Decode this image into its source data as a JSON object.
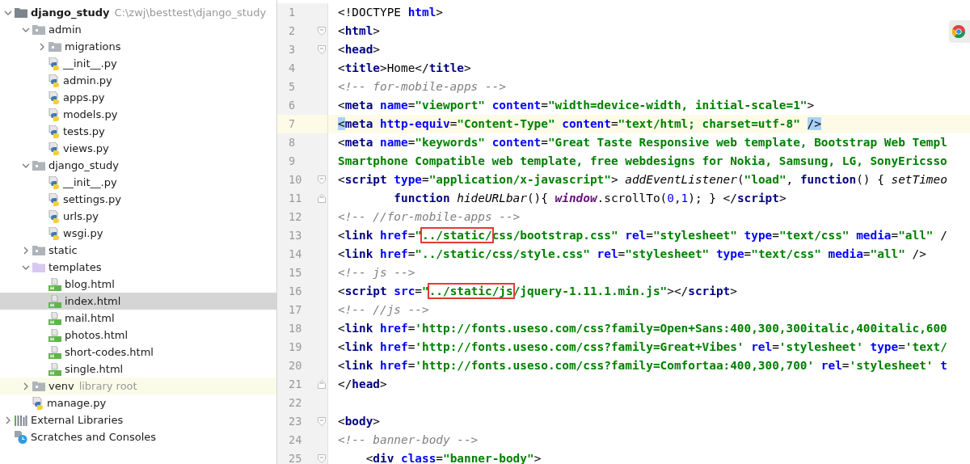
{
  "project_tree": {
    "root": {
      "name": "django_study",
      "path": "C:\\zwj\\besttest\\django_study",
      "expanded": true
    },
    "children": [
      {
        "kind": "folder",
        "name": "admin",
        "expanded": true,
        "selected": false,
        "children": [
          {
            "kind": "folder",
            "name": "migrations",
            "expanded": false,
            "selected": false
          },
          {
            "kind": "py",
            "name": "__init__.py",
            "selected": false
          },
          {
            "kind": "py",
            "name": "admin.py",
            "selected": false
          },
          {
            "kind": "py",
            "name": "apps.py",
            "selected": false
          },
          {
            "kind": "py",
            "name": "models.py",
            "selected": false
          },
          {
            "kind": "py",
            "name": "tests.py",
            "selected": false
          },
          {
            "kind": "py",
            "name": "views.py",
            "selected": false
          }
        ]
      },
      {
        "kind": "folder",
        "name": "django_study",
        "expanded": true,
        "selected": false,
        "children": [
          {
            "kind": "py",
            "name": "__init__.py",
            "selected": false
          },
          {
            "kind": "py",
            "name": "settings.py",
            "selected": false
          },
          {
            "kind": "py",
            "name": "urls.py",
            "selected": false
          },
          {
            "kind": "py",
            "name": "wsgi.py",
            "selected": false
          }
        ]
      },
      {
        "kind": "folder",
        "name": "static",
        "expanded": false,
        "selected": false
      },
      {
        "kind": "templates",
        "name": "templates",
        "expanded": true,
        "selected": false,
        "children": [
          {
            "kind": "html",
            "name": "blog.html",
            "selected": false
          },
          {
            "kind": "html",
            "name": "index.html",
            "selected": true
          },
          {
            "kind": "html",
            "name": "mail.html",
            "selected": false
          },
          {
            "kind": "html",
            "name": "photos.html",
            "selected": false
          },
          {
            "kind": "html",
            "name": "short-codes.html",
            "selected": false
          },
          {
            "kind": "html",
            "name": "single.html",
            "selected": false
          }
        ]
      },
      {
        "kind": "folder",
        "name": "venv",
        "hint": "library root",
        "expanded": false,
        "selected": false
      },
      {
        "kind": "py",
        "name": "manage.py",
        "selected": false
      }
    ],
    "extra": [
      {
        "kind": "libraries",
        "name": "External Libraries",
        "expanded": false
      },
      {
        "kind": "scratches",
        "name": "Scratches and Consoles"
      }
    ]
  },
  "editor": {
    "lines": [
      {
        "number": "1",
        "current": false,
        "tokens": [
          {
            "kind": "p",
            "text": "<!DOCTYPE"
          },
          {
            "kind": "attr",
            "text": " html"
          },
          {
            "kind": "p",
            "text": ">"
          }
        ]
      },
      {
        "number": "2",
        "current": false,
        "fold_start": true,
        "tokens": [
          {
            "kind": "p",
            "text": "<"
          },
          {
            "kind": "tag",
            "text": "html"
          },
          {
            "kind": "p",
            "text": ">"
          }
        ]
      },
      {
        "number": "3",
        "current": false,
        "fold_start": true,
        "tokens": [
          {
            "kind": "p",
            "text": "<"
          },
          {
            "kind": "tag",
            "text": "head"
          },
          {
            "kind": "p",
            "text": ">"
          }
        ]
      },
      {
        "number": "4",
        "current": false,
        "tokens": [
          {
            "kind": "p",
            "text": "<"
          },
          {
            "kind": "tag",
            "text": "title"
          },
          {
            "kind": "p",
            "text": ">"
          },
          {
            "kind": "text",
            "text": "Home"
          },
          {
            "kind": "p",
            "text": "</"
          },
          {
            "kind": "tag",
            "text": "title"
          },
          {
            "kind": "p",
            "text": ">"
          }
        ]
      },
      {
        "number": "5",
        "current": false,
        "tokens": [
          {
            "kind": "comment",
            "text": "<!-- for-mobile-apps -->"
          }
        ]
      },
      {
        "number": "6",
        "current": false,
        "tokens": [
          {
            "kind": "p",
            "text": "<"
          },
          {
            "kind": "tag",
            "text": "meta"
          },
          {
            "kind": "attr",
            "text": " name"
          },
          {
            "kind": "p",
            "text": "="
          },
          {
            "kind": "str",
            "text": "\"viewport\""
          },
          {
            "kind": "attr",
            "text": " content"
          },
          {
            "kind": "p",
            "text": "="
          },
          {
            "kind": "str",
            "text": "\"width=device-width, initial-scale=1\""
          },
          {
            "kind": "p",
            "text": ">"
          }
        ]
      },
      {
        "number": "7",
        "current": true,
        "tokens": [
          {
            "kind": "pm",
            "text": "<"
          },
          {
            "kind": "tag",
            "text": "meta"
          },
          {
            "kind": "attr",
            "text": " http-equiv"
          },
          {
            "kind": "p",
            "text": "="
          },
          {
            "kind": "str",
            "text": "\"Content-Type\""
          },
          {
            "kind": "attr",
            "text": " content"
          },
          {
            "kind": "p",
            "text": "="
          },
          {
            "kind": "str",
            "text": "\"text/html; charset=utf-8\" "
          },
          {
            "kind": "pm",
            "text": "/>"
          }
        ]
      },
      {
        "number": "8",
        "current": false,
        "tokens": [
          {
            "kind": "p",
            "text": "<"
          },
          {
            "kind": "tag",
            "text": "meta"
          },
          {
            "kind": "attr",
            "text": " name"
          },
          {
            "kind": "p",
            "text": "="
          },
          {
            "kind": "str",
            "text": "\"keywords\""
          },
          {
            "kind": "attr",
            "text": " content"
          },
          {
            "kind": "p",
            "text": "="
          },
          {
            "kind": "str",
            "text": "\"Great Taste Responsive web template, Bootstrap Web Templ"
          }
        ]
      },
      {
        "number": "9",
        "current": false,
        "tokens": [
          {
            "kind": "str",
            "text": "Smartphone Compatible web template, free webdesigns for Nokia, Samsung, LG, SonyEricsso"
          }
        ]
      },
      {
        "number": "10",
        "current": false,
        "fold_start": true,
        "tokens": [
          {
            "kind": "p",
            "text": "<"
          },
          {
            "kind": "tag",
            "text": "script"
          },
          {
            "kind": "attr",
            "text": " type"
          },
          {
            "kind": "p",
            "text": "="
          },
          {
            "kind": "str",
            "text": "\"application/x-javascript\""
          },
          {
            "kind": "p",
            "text": ">"
          },
          {
            "kind": "it",
            "text": " addEventListener"
          },
          {
            "kind": "p",
            "text": "("
          },
          {
            "kind": "str",
            "text": "\"load\""
          },
          {
            "kind": "p",
            "text": ","
          },
          {
            "kind": "kw",
            "text": " function"
          },
          {
            "kind": "p",
            "text": "() {"
          },
          {
            "kind": "it",
            "text": " setTimeo"
          }
        ]
      },
      {
        "number": "11",
        "current": false,
        "fold_end": true,
        "tokens": [
          {
            "kind": "kw",
            "text": "        function"
          },
          {
            "kind": "it",
            "text": " hideURLbar"
          },
          {
            "kind": "p",
            "text": "(){"
          },
          {
            "kind": "glob",
            "text": " window"
          },
          {
            "kind": "p",
            "text": ".scrollTo("
          },
          {
            "kind": "num",
            "text": "0"
          },
          {
            "kind": "p",
            "text": ","
          },
          {
            "kind": "num",
            "text": "1"
          },
          {
            "kind": "p",
            "text": "); } </"
          },
          {
            "kind": "tag",
            "text": "script"
          },
          {
            "kind": "p",
            "text": ">"
          }
        ]
      },
      {
        "number": "12",
        "current": false,
        "tokens": [
          {
            "kind": "comment",
            "text": "<!-- //for-mobile-apps -->"
          }
        ]
      },
      {
        "number": "13",
        "current": false,
        "tokens": [
          {
            "kind": "p",
            "text": "<"
          },
          {
            "kind": "tag",
            "text": "link"
          },
          {
            "kind": "attr",
            "text": " href"
          },
          {
            "kind": "p",
            "text": "="
          },
          {
            "kind": "str",
            "text": "\""
          },
          {
            "kind": "boxed",
            "text": "../static/"
          },
          {
            "kind": "str",
            "text": "css/bootstrap.css\""
          },
          {
            "kind": "attr",
            "text": " rel"
          },
          {
            "kind": "p",
            "text": "="
          },
          {
            "kind": "str",
            "text": "\"stylesheet\""
          },
          {
            "kind": "attr",
            "text": " type"
          },
          {
            "kind": "p",
            "text": "="
          },
          {
            "kind": "str",
            "text": "\"text/css\""
          },
          {
            "kind": "attr",
            "text": " media"
          },
          {
            "kind": "p",
            "text": "="
          },
          {
            "kind": "str",
            "text": "\"all\""
          },
          {
            "kind": "p",
            "text": " /"
          }
        ]
      },
      {
        "number": "14",
        "current": false,
        "tokens": [
          {
            "kind": "p",
            "text": "<"
          },
          {
            "kind": "tag",
            "text": "link"
          },
          {
            "kind": "attr",
            "text": " href"
          },
          {
            "kind": "p",
            "text": "="
          },
          {
            "kind": "str",
            "text": "\"../static/css/style.css\""
          },
          {
            "kind": "attr",
            "text": " rel"
          },
          {
            "kind": "p",
            "text": "="
          },
          {
            "kind": "str",
            "text": "\"stylesheet\""
          },
          {
            "kind": "attr",
            "text": " type"
          },
          {
            "kind": "p",
            "text": "="
          },
          {
            "kind": "str",
            "text": "\"text/css\""
          },
          {
            "kind": "attr",
            "text": " media"
          },
          {
            "kind": "p",
            "text": "="
          },
          {
            "kind": "str",
            "text": "\"all\""
          },
          {
            "kind": "p",
            "text": " />"
          }
        ]
      },
      {
        "number": "15",
        "current": false,
        "tokens": [
          {
            "kind": "comment",
            "text": "<!-- js -->"
          }
        ]
      },
      {
        "number": "16",
        "current": false,
        "tokens": [
          {
            "kind": "p",
            "text": "<"
          },
          {
            "kind": "tag",
            "text": "script"
          },
          {
            "kind": "attr",
            "text": " src"
          },
          {
            "kind": "p",
            "text": "="
          },
          {
            "kind": "str",
            "text": "\""
          },
          {
            "kind": "boxed",
            "text": "../static/js"
          },
          {
            "kind": "str",
            "text": "/jquery-1.11.1.min.js\""
          },
          {
            "kind": "p",
            "text": "></"
          },
          {
            "kind": "tag",
            "text": "script"
          },
          {
            "kind": "p",
            "text": ">"
          }
        ]
      },
      {
        "number": "17",
        "current": false,
        "tokens": [
          {
            "kind": "comment",
            "text": "<!-- //js -->"
          }
        ]
      },
      {
        "number": "18",
        "current": false,
        "tokens": [
          {
            "kind": "p",
            "text": "<"
          },
          {
            "kind": "tag",
            "text": "link"
          },
          {
            "kind": "attr",
            "text": " href"
          },
          {
            "kind": "p",
            "text": "="
          },
          {
            "kind": "str",
            "text": "'http://fonts.useso.com/css?family=Open+Sans:400,300,300italic,400italic,600"
          }
        ]
      },
      {
        "number": "19",
        "current": false,
        "tokens": [
          {
            "kind": "p",
            "text": "<"
          },
          {
            "kind": "tag",
            "text": "link"
          },
          {
            "kind": "attr",
            "text": " href"
          },
          {
            "kind": "p",
            "text": "="
          },
          {
            "kind": "str",
            "text": "'http://fonts.useso.com/css?family=Great+Vibes'"
          },
          {
            "kind": "attr",
            "text": " rel"
          },
          {
            "kind": "p",
            "text": "="
          },
          {
            "kind": "str",
            "text": "'stylesheet'"
          },
          {
            "kind": "attr",
            "text": " type"
          },
          {
            "kind": "p",
            "text": "="
          },
          {
            "kind": "str",
            "text": "'text/"
          }
        ]
      },
      {
        "number": "20",
        "current": false,
        "tokens": [
          {
            "kind": "p",
            "text": "<"
          },
          {
            "kind": "tag",
            "text": "link"
          },
          {
            "kind": "attr",
            "text": " href"
          },
          {
            "kind": "p",
            "text": "="
          },
          {
            "kind": "str",
            "text": "'http://fonts.useso.com/css?family=Comfortaa:400,300,700'"
          },
          {
            "kind": "attr",
            "text": " rel"
          },
          {
            "kind": "p",
            "text": "="
          },
          {
            "kind": "str",
            "text": "'stylesheet'"
          },
          {
            "kind": "attr",
            "text": " t"
          }
        ]
      },
      {
        "number": "21",
        "current": false,
        "fold_end": true,
        "tokens": [
          {
            "kind": "p",
            "text": "</"
          },
          {
            "kind": "tag",
            "text": "head"
          },
          {
            "kind": "p",
            "text": ">"
          }
        ]
      },
      {
        "number": "22",
        "current": false
      },
      {
        "number": "23",
        "current": false,
        "fold_start": true,
        "tokens": [
          {
            "kind": "p",
            "text": "<"
          },
          {
            "kind": "tag",
            "text": "body"
          },
          {
            "kind": "p",
            "text": ">"
          }
        ]
      },
      {
        "number": "24",
        "current": false,
        "tokens": [
          {
            "kind": "comment",
            "text": "<!-- banner-body -->"
          }
        ]
      },
      {
        "number": "25",
        "current": false,
        "fold_start": true,
        "tokens": [
          {
            "kind": "p",
            "text": "    <"
          },
          {
            "kind": "tag",
            "text": "div"
          },
          {
            "kind": "attr",
            "text": " class"
          },
          {
            "kind": "p",
            "text": "="
          },
          {
            "kind": "str",
            "text": "\"banner-body\""
          },
          {
            "kind": "p",
            "text": ">"
          }
        ]
      }
    ]
  }
}
